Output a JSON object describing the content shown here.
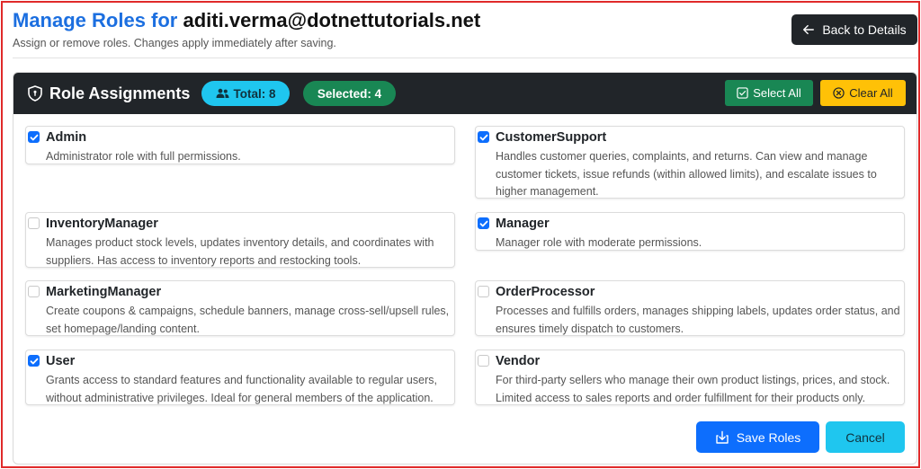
{
  "header": {
    "title_prefix": "Manage Roles for",
    "email": "aditi.verma@dotnettutorials.net",
    "subtitle": "Assign or remove roles. Changes apply immediately after saving.",
    "back_label": "Back to Details"
  },
  "card": {
    "title": "Role Assignments",
    "total_label": "Total: 8",
    "selected_label": "Selected: 4",
    "select_all_label": "Select All",
    "clear_all_label": "Clear All"
  },
  "roles": [
    {
      "name": "Admin",
      "checked": true,
      "description": "Administrator role with full permissions."
    },
    {
      "name": "CustomerSupport",
      "checked": true,
      "description": "Handles customer queries, complaints, and returns. Can view and manage customer tickets, issue refunds (within allowed limits), and escalate issues to higher management."
    },
    {
      "name": "InventoryManager",
      "checked": false,
      "description": "Manages product stock levels, updates inventory details, and coordinates with suppliers. Has access to inventory reports and restocking tools."
    },
    {
      "name": "Manager",
      "checked": true,
      "description": "Manager role with moderate permissions."
    },
    {
      "name": "MarketingManager",
      "checked": false,
      "description": "Create coupons & campaigns, schedule banners, manage cross-sell/upsell rules, set homepage/landing content."
    },
    {
      "name": "OrderProcessor",
      "checked": false,
      "description": "Processes and fulfills orders, manages shipping labels, updates order status, and ensures timely dispatch to customers."
    },
    {
      "name": "User",
      "checked": true,
      "description": "Grants access to standard features and functionality available to regular users, without administrative privileges. Ideal for general members of the application."
    },
    {
      "name": "Vendor",
      "checked": false,
      "description": "For third-party sellers who manage their own product listings, prices, and stock. Limited access to sales reports and order fulfillment for their products only."
    }
  ],
  "footer": {
    "save_label": "Save Roles",
    "cancel_label": "Cancel"
  },
  "colors": {
    "primary": "#0d6efd",
    "title_blue": "#1c6fe0",
    "success": "#198754",
    "info": "#1fc6ef",
    "warning": "#ffc107",
    "dark": "#212529",
    "frame_red": "#e02a2a"
  },
  "icons": {
    "back": "arrow-left-icon",
    "header": "shield-icon",
    "total": "users-icon",
    "select_all": "check-square-icon",
    "clear_all": "x-circle-icon",
    "save": "download-icon",
    "checkbox": "check-icon"
  }
}
